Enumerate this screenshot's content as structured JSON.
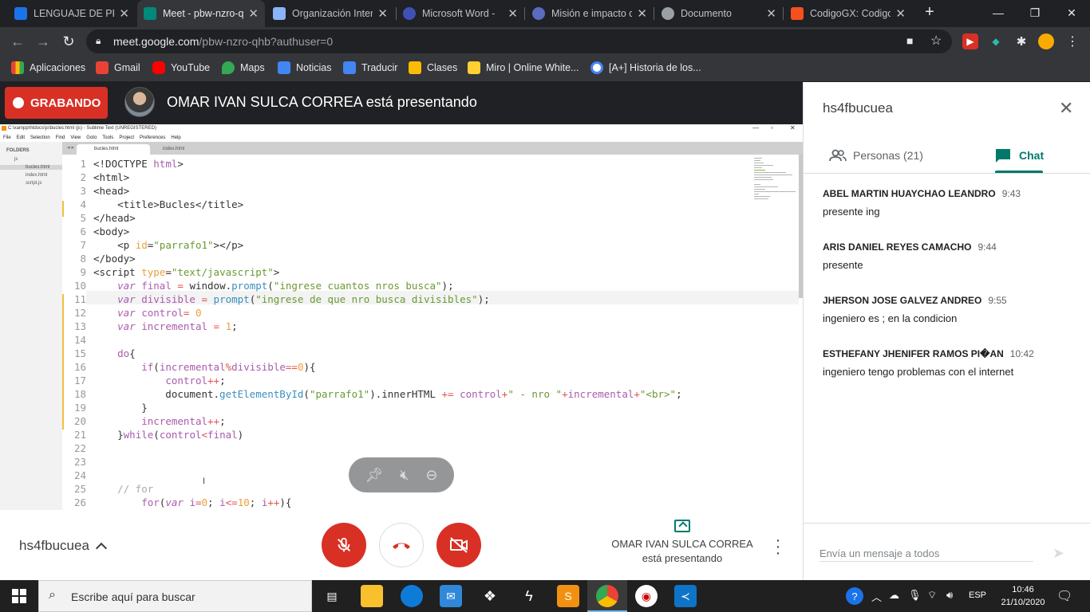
{
  "browser": {
    "tabs": [
      {
        "title": "LENGUAJE DE PROGRAMACIÓN",
        "color": "#1a73e8"
      },
      {
        "title": "Meet - pbw-nzro-qhb",
        "color": "#00897b"
      },
      {
        "title": "Organización Internacional",
        "color": "#8ab4f8"
      },
      {
        "title": "Microsoft Word - ",
        "color": "#3f51b5"
      },
      {
        "title": "Misión e impacto de",
        "color": "#5c6bc0"
      },
      {
        "title": "Documento",
        "color": "#9aa0a6"
      },
      {
        "title": "CodigoGX: Codigo",
        "color": "#f4511e"
      }
    ],
    "new_tab": "+",
    "url_host": "meet.google.com",
    "url_path": "/pbw-nzro-qhb?authuser=0",
    "bookmarks": [
      "Aplicaciones",
      "Gmail",
      "YouTube",
      "Maps",
      "Noticias",
      "Traducir",
      "Clases",
      "Miro | Online White...",
      "[A+] Historia de los..."
    ]
  },
  "meet": {
    "recording_label": "GRABANDO",
    "presenter_text": "OMAR IVAN SULCA CORREA está presentando",
    "meeting_code": "hs4fbucuea",
    "present_label_1": "OMAR IVAN SULCA CORREA",
    "present_label_2": "está presentando"
  },
  "sublime": {
    "title": "C:\\xampp\\htdocs\\js\\bucles.html (js) - Sublime Text (UNREGISTERED)",
    "menu": [
      "File",
      "Edit",
      "Selection",
      "Find",
      "View",
      "Goto",
      "Tools",
      "Project",
      "Preferences",
      "Help"
    ],
    "folders_label": "FOLDERS",
    "tree": [
      "js",
      "bucles.html",
      "index.html",
      "script.js"
    ],
    "tabs": [
      "bucles.html",
      "index.html"
    ],
    "line_numbers": [
      "1",
      "2",
      "3",
      "4",
      "5",
      "6",
      "7",
      "8",
      "9",
      "10",
      "11",
      "12",
      "13",
      "14",
      "15",
      "16",
      "17",
      "18",
      "19",
      "20",
      "21",
      "22",
      "23",
      "24",
      "25",
      "26"
    ]
  },
  "panel": {
    "title": "hs4fbucuea",
    "people_tab": "Personas (21)",
    "chat_tab": "Chat",
    "messages": [
      {
        "author": "ABEL MARTIN HUAYCHAO LEANDRO",
        "time": "9:43",
        "text": "presente ing"
      },
      {
        "author": "ARIS DANIEL REYES CAMACHO",
        "time": "9:44",
        "text": "presente"
      },
      {
        "author": "JHERSON JOSE GALVEZ ANDREO",
        "time": "9:55",
        "text": "ingeniero es ; en la condicion"
      },
      {
        "author": "ESTHEFANY JHENIFER RAMOS PI�AN",
        "time": "10:42",
        "text": "ingeniero tengo problemas con el internet"
      }
    ],
    "input_placeholder": "Envía un mensaje a todos"
  },
  "taskbar": {
    "search_placeholder": "Escribe aquí para buscar",
    "lang": "ESP",
    "time": "10:46",
    "date": "21/10/2020"
  },
  "colors": {
    "accent": "#00796b",
    "danger": "#d93025"
  }
}
